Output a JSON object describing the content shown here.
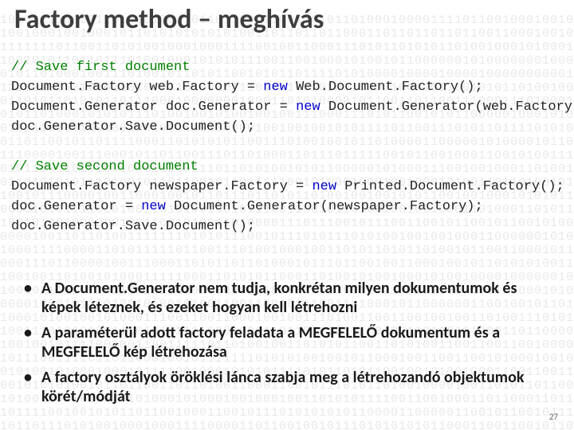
{
  "title": "Factory method – meghívás",
  "code": {
    "c1": "// Save first document",
    "l2a": "Document.Factory web.Factory = ",
    "l2b": "new",
    "l2c": " Web.Document.Factory();",
    "l3a": "Document.Generator doc.Generator = ",
    "l3b": "new",
    "l3c": " Document.Generator(web.Factory);",
    "l4": "doc.Generator.Save.Document();",
    "c2": "// Save second document",
    "l6a": "Document.Factory newspaper.Factory = ",
    "l6b": "new",
    "l6c": " Printed.Document.Factory();",
    "l7a": "doc.Generator = ",
    "l7b": "new",
    "l7c": " Document.Generator(newspaper.Factory);",
    "l8": "doc.Generator.Save.Document();"
  },
  "bullets": [
    "A Document.Generator nem tudja, konkrétan milyen dokumentumok és képek léteznek, és ezeket hogyan kell létrehozni",
    "A paraméterül adott factory feladata a MEGFELELŐ dokumentum és a MEGFELELŐ kép létrehozása",
    "A factory osztályok öröklési lánca szabja meg a létrehozandó objektumok körét/módját"
  ],
  "page": "27"
}
